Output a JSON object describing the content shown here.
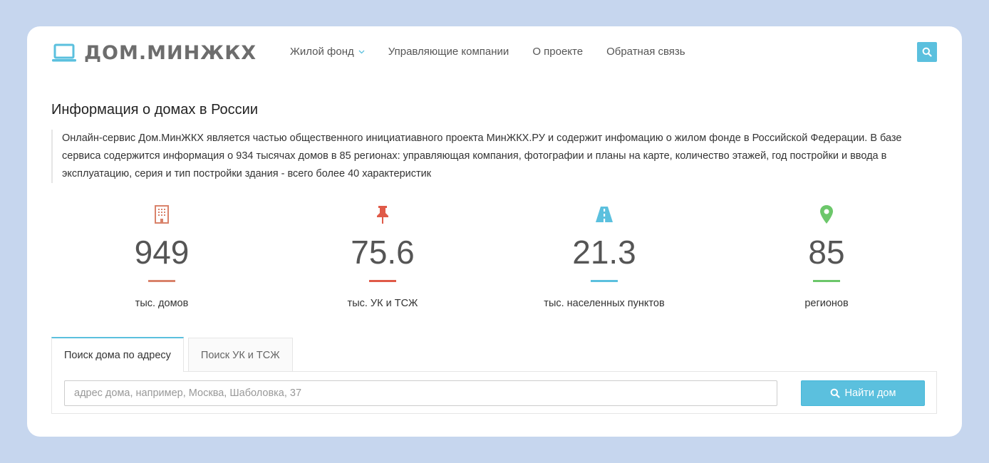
{
  "header": {
    "logo_text": "ДОМ.МИНЖКХ",
    "nav": [
      {
        "label": "Жилой фонд",
        "has_dropdown": true
      },
      {
        "label": "Управляющие компании"
      },
      {
        "label": "О проекте"
      },
      {
        "label": "Обратная связь"
      }
    ]
  },
  "main": {
    "title": "Информация о домах в России",
    "intro": "Онлайн-сервис Дом.МинЖКХ является частью общественного инициатиавного проекта МинЖКХ.РУ и содержит инфомацию о жилом фонде в Российской Федерации. В базе сервиса содержится информация о 934 тысячах домов в 85 регионах: управляющая компания, фотографии и планы на карте, количество этажей, год постройки и ввода в эксплуатацию, серия и тип постройки здания - всего более 40 характеристик"
  },
  "stats": [
    {
      "icon": "building-icon",
      "value": "949",
      "label": "тыс. домов",
      "color": "#d9826a"
    },
    {
      "icon": "pushpin-icon",
      "value": "75.6",
      "label": "тыс. УК и ТСЖ",
      "color": "#e05a48"
    },
    {
      "icon": "road-icon",
      "value": "21.3",
      "label": "тыс. населенных пунктов",
      "color": "#5bc0de"
    },
    {
      "icon": "map-marker-icon",
      "value": "85",
      "label": "регионов",
      "color": "#6cc76a"
    }
  ],
  "search": {
    "tabs": [
      {
        "label": "Поиск дома по адресу",
        "active": true
      },
      {
        "label": "Поиск УК и ТСЖ",
        "active": false
      }
    ],
    "placeholder": "адрес дома, например, Москва, Шаболовка, 37",
    "value": "",
    "button_label": "Найти дом"
  },
  "colors": {
    "accent": "#5bc0de",
    "background": "#c6d6ee"
  }
}
